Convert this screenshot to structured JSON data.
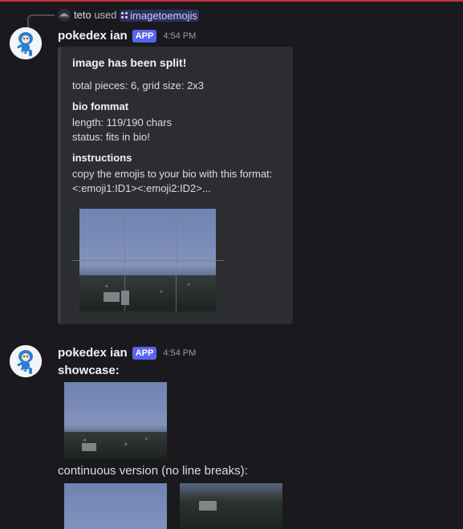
{
  "reply": {
    "user": "teto",
    "action": "used",
    "command": "imagetoemojis"
  },
  "messages": [
    {
      "author": "pokedex ian",
      "badge": "APP",
      "time": "4:54 PM",
      "embed": {
        "title": "image has been split!",
        "summary": "total pieces: 6, grid size: 2x3",
        "bio_heading": "bio fommat",
        "bio_length": "length: 119/190 chars",
        "bio_status": "status: fits in bio!",
        "instructions_heading": "instructions",
        "instructions_line1": "copy the emojis to your bio with this format:",
        "instructions_line2": "<:emoji1:ID1><:emoji2:ID2>..."
      }
    },
    {
      "author": "pokedex ian",
      "badge": "APP",
      "time": "4:54 PM",
      "showcase_label": "showcase:",
      "continuous_label": "continuous version (no line breaks):"
    }
  ],
  "colors": {
    "background": "#1a1a1e",
    "embed": "#2b2d31",
    "app_badge": "#5865f2",
    "top_accent": "#c9343b"
  }
}
